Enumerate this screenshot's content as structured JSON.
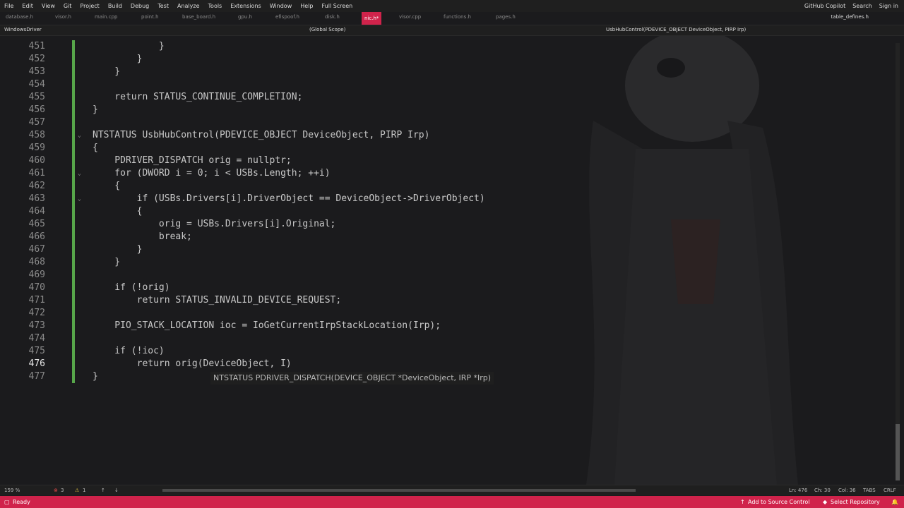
{
  "menu": [
    "File",
    "Edit",
    "View",
    "Git",
    "Project",
    "Build",
    "Debug",
    "Test",
    "Analyze",
    "Tools",
    "Extensions",
    "Window",
    "Help",
    "Full Screen"
  ],
  "menu_right": {
    "copilot": "GitHub Copilot",
    "search": "Search",
    "signin": "Sign in"
  },
  "tabs": [
    "database.h",
    "visor.h",
    "main.cpp",
    "point.h",
    "base_board.h",
    "gpu.h",
    "efispoof.h",
    "disk.h",
    "nic.h*",
    "visor.cpp",
    "functions.h",
    "pages.h"
  ],
  "active_tab": "nic.h*",
  "right_tab": "table_defines.h",
  "nav": {
    "project": "WindowsDriver",
    "scope": "(Global Scope)",
    "member": "UsbHubControl(PDEVICE_OBJECT DeviceObject, PIRP Irp)"
  },
  "lines": [
    {
      "n": "451",
      "t": "            }"
    },
    {
      "n": "452",
      "t": "        }"
    },
    {
      "n": "453",
      "t": "    }"
    },
    {
      "n": "454",
      "t": ""
    },
    {
      "n": "455",
      "t": "    return STATUS_CONTINUE_COMPLETION;"
    },
    {
      "n": "456",
      "t": "}"
    },
    {
      "n": "457",
      "t": ""
    },
    {
      "n": "458",
      "t": "NTSTATUS UsbHubControl(PDEVICE_OBJECT DeviceObject, PIRP Irp)"
    },
    {
      "n": "459",
      "t": "{"
    },
    {
      "n": "460",
      "t": "    PDRIVER_DISPATCH orig = nullptr;"
    },
    {
      "n": "461",
      "t": "    for (DWORD i = 0; i < USBs.Length; ++i)"
    },
    {
      "n": "462",
      "t": "    {"
    },
    {
      "n": "463",
      "t": "        if (USBs.Drivers[i].DriverObject == DeviceObject->DriverObject)"
    },
    {
      "n": "464",
      "t": "        {"
    },
    {
      "n": "465",
      "t": "            orig = USBs.Drivers[i].Original;"
    },
    {
      "n": "466",
      "t": "            break;"
    },
    {
      "n": "467",
      "t": "        }"
    },
    {
      "n": "468",
      "t": "    }"
    },
    {
      "n": "469",
      "t": ""
    },
    {
      "n": "470",
      "t": "    if (!orig)"
    },
    {
      "n": "471",
      "t": "        return STATUS_INVALID_DEVICE_REQUEST;"
    },
    {
      "n": "472",
      "t": ""
    },
    {
      "n": "473",
      "t": "    PIO_STACK_LOCATION ioc = IoGetCurrentIrpStackLocation(Irp);"
    },
    {
      "n": "474",
      "t": ""
    },
    {
      "n": "475",
      "t": "    if (!ioc)"
    },
    {
      "n": "476",
      "t": "        return orig(DeviceObject, I)"
    },
    {
      "n": "477",
      "t": "}"
    }
  ],
  "tooltip": "NTSTATUS PDRIVER_DISPATCH(DEVICE_OBJECT *DeviceObject, IRP *Irp)",
  "bottom": {
    "zoom": "159 %",
    "errors": "3",
    "warnings": "1",
    "ln": "Ln: 476",
    "ch": "Ch: 30",
    "col": "Col: 36",
    "tabs": "TABS",
    "eol": "CRLF"
  },
  "status": {
    "ready": "Ready",
    "source": "Add to Source Control",
    "repo": "Select Repository"
  },
  "colors": {
    "accent": "#d0234b",
    "change_bar": "#57a64a",
    "editor_bg": "#1b1b1d"
  }
}
